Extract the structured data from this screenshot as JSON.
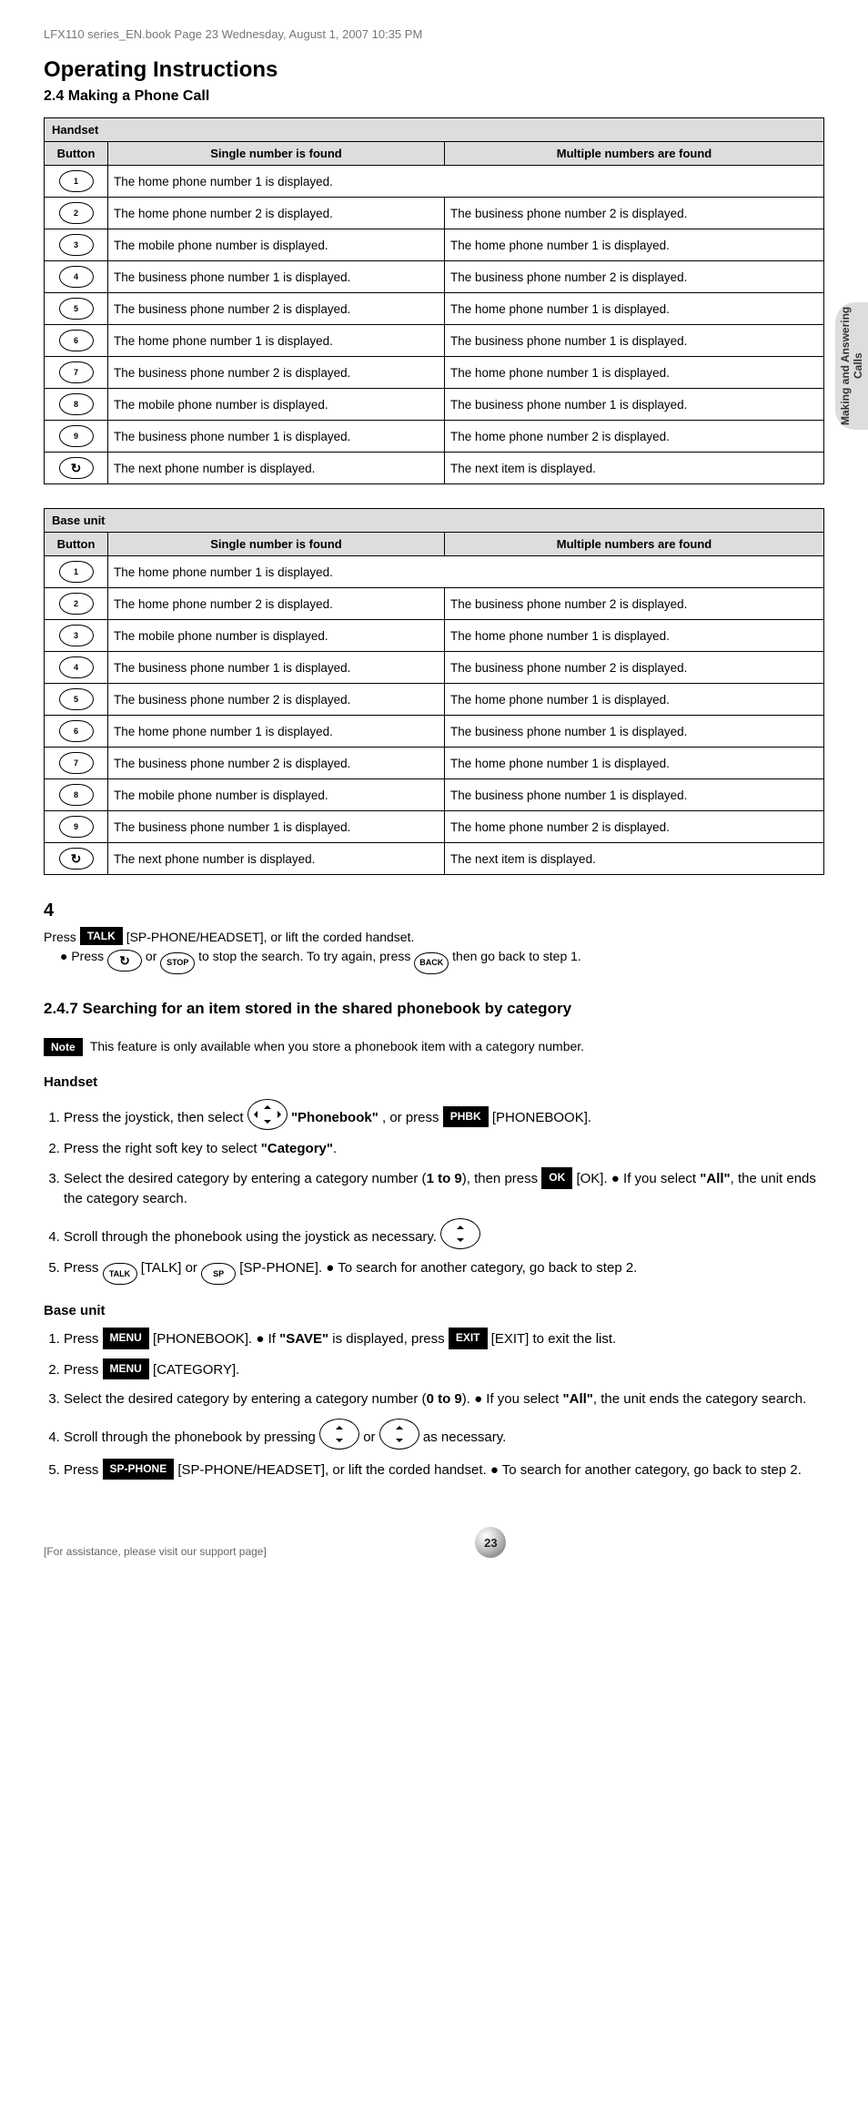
{
  "page_header": "LFX110 series_EN.book  Page 23  Wednesday, August 1, 2007  10:35 PM",
  "title": "Operating Instructions",
  "subtitle": "2.4 Making a Phone Call",
  "side_tab": "Making and Answering Calls",
  "table1": {
    "modehdr": "Handset",
    "headers": [
      "Button",
      "Single number is found",
      "Multiple numbers are found"
    ],
    "rows": [
      {
        "key": "1",
        "a": "The home phone number 1 is displayed."
      },
      {
        "key": "2",
        "a": "The home phone number 2 is displayed.",
        "b": "The business phone number 2 is displayed."
      },
      {
        "key": "3",
        "a": "The mobile phone number is displayed.",
        "b": "The home phone number 1 is displayed."
      },
      {
        "key": "4",
        "a": "The business phone number 1 is displayed.",
        "b": "The business phone number 2 is displayed."
      },
      {
        "key": "5",
        "a": "The business phone number 2 is displayed.",
        "b": "The home phone number 1 is displayed."
      },
      {
        "key": "6",
        "a": "The home phone number 1 is displayed.",
        "b": "The business phone number 1 is displayed."
      },
      {
        "key": "7",
        "a": "The business phone number 2 is displayed.",
        "b": "The home phone number 1 is displayed."
      },
      {
        "key": "8",
        "a": "The mobile phone number is displayed.",
        "b": "The business phone number 1 is displayed."
      },
      {
        "key": "9",
        "a": "The business phone number 1 is displayed.",
        "b": "The home phone number 2 is displayed."
      },
      {
        "key": "refresh",
        "a": "The next phone number is displayed.",
        "b": "The next item is displayed."
      }
    ]
  },
  "table2": {
    "modehdr": "Base unit",
    "headers": [
      "Button",
      "Single number is found",
      "Multiple numbers are found"
    ],
    "rows": [
      {
        "key": "1",
        "a": "The home phone number 1 is displayed."
      },
      {
        "key": "2",
        "a": "The home phone number 2 is displayed.",
        "b": "The business phone number 2 is displayed."
      },
      {
        "key": "3",
        "a": "The mobile phone number is displayed.",
        "b": "The home phone number 1 is displayed."
      },
      {
        "key": "4",
        "a": "The business phone number 1 is displayed.",
        "b": "The business phone number 2 is displayed."
      },
      {
        "key": "5",
        "a": "The business phone number 2 is displayed.",
        "b": "The home phone number 1 is displayed."
      },
      {
        "key": "6",
        "a": "The home phone number 1 is displayed.",
        "b": "The business phone number 1 is displayed."
      },
      {
        "key": "7",
        "a": "The business phone number 2 is displayed.",
        "b": "The home phone number 1 is displayed."
      },
      {
        "key": "8",
        "a": "The mobile phone number is displayed.",
        "b": "The business phone number 1 is displayed."
      },
      {
        "key": "9",
        "a": "The business phone number 1 is displayed.",
        "b": "The home phone number 2 is displayed."
      },
      {
        "key": "refresh",
        "a": "The next phone number is displayed.",
        "b": "The next item is displayed."
      }
    ]
  },
  "steps": {
    "s4": {
      "num": "4",
      "pre": "Press ",
      "mid": " [SP-PHONE/HEADSET], or lift the corded handset.",
      "bullet_intro": "● Press ",
      "bullet_or": " or ",
      "bullet_mid": " to stop the search. To try again, press ",
      "bullet_end": " then go back to step 1.",
      "key_talk": "TALK",
      "key_refresh": "↻",
      "key_stop": "STOP",
      "key_back": "BACK"
    },
    "search_heading": "2.4.7 Searching for an item stored in the shared phonebook by category",
    "s_note_label": "Note",
    "s_note_text": "This feature is only available when you store a phonebook item with a category number.",
    "hs_label": "Handset",
    "bu_label": "Base unit",
    "hs": {
      "i1_a": "Press the joystick, then select ",
      "i1_q": "\"Phonebook\"",
      "i1_b": ", or press ",
      "i1_key": "PHBK",
      "i1_c": " [PHONEBOOK].",
      "i2_a": "Press the right soft key to select ",
      "i2_q": "\"Category\"",
      "i2_b": ".",
      "i3_a": "Select the desired category by entering a category number (",
      "i3_r": "1 to 9",
      "i3_b": "), then press ",
      "i3_key": "OK",
      "i3_c": " [OK].  ● If you select ",
      "i3_q": "\"All\"",
      "i3_d": ", the unit ends the category search.",
      "i4_a": "Scroll through the phonebook using the joystick as necessary.",
      "i5_a": "Press ",
      "i5_k1": "TALK",
      "i5_mid": " [TALK] or ",
      "i5_k2": "SP",
      "i5_b": " [SP-PHONE].  ● To search for another category, go back to step 2."
    },
    "bu": {
      "i1_a": "Press ",
      "i1_k": "MENU",
      "i1_b": " [PHONEBOOK].  ● If ",
      "i1_q": "\"SAVE\"",
      "i1_c": " is displayed, press ",
      "i1_k2": "EXIT",
      "i1_d": " [EXIT] to exit the list.",
      "i2_a": "Press ",
      "i2_k": "MENU",
      "i2_b": " [CATEGORY].",
      "i3_a": "Select the desired category by entering a category number (",
      "i3_r": "0 to 9",
      "i3_b": ").  ● If you select ",
      "i3_q": "\"All\"",
      "i3_c": ", the unit ends the category search.",
      "i4_a": "Scroll through the phonebook by pressing ",
      "i4_or": " or ",
      "i4_b": " as necessary.",
      "i5_a": "Press ",
      "i5_k": "SP-PHONE",
      "i5_b": " [SP-PHONE/HEADSET], or lift the corded handset.  ● To search for another category, go back to step 2."
    }
  },
  "footer": {
    "left": "[For assistance, please visit our support page]",
    "page": "23"
  }
}
